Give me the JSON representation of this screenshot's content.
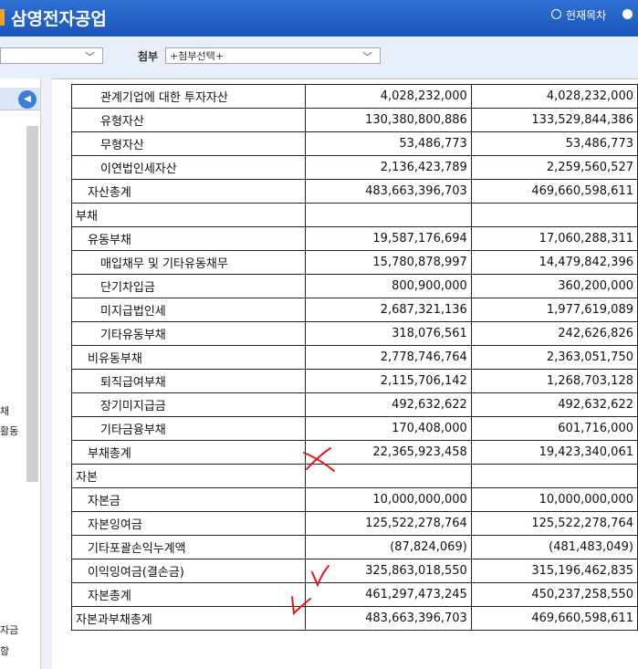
{
  "header": {
    "title": "삼영전자공업",
    "radio_label": "현재목차"
  },
  "filters": {
    "attach_label": "첨부",
    "attach_value": "+첨부선택+"
  },
  "left_panel": {
    "fragments": [
      "채",
      "활동",
      "자금",
      "항"
    ]
  },
  "table": {
    "rows": [
      {
        "label": "관계기업에 대한 투자자산",
        "level": 2,
        "v1": "4,028,232,000",
        "v2": "4,028,232,000"
      },
      {
        "label": "유형자산",
        "level": 2,
        "v1": "130,380,800,886",
        "v2": "133,529,844,386"
      },
      {
        "label": "무형자산",
        "level": 2,
        "v1": "53,486,773",
        "v2": "53,486,773"
      },
      {
        "label": "이연법인세자산",
        "level": 2,
        "v1": "2,136,423,789",
        "v2": "2,259,560,527"
      },
      {
        "label": "자산총계",
        "level": 1,
        "v1": "483,663,396,703",
        "v2": "469,660,598,611"
      },
      {
        "label": "부채",
        "level": 0,
        "v1": "",
        "v2": ""
      },
      {
        "label": "유동부채",
        "level": 1,
        "v1": "19,587,176,694",
        "v2": "17,060,288,311"
      },
      {
        "label": "매입채무 및 기타유동채무",
        "level": 2,
        "v1": "15,780,878,997",
        "v2": "14,479,842,396"
      },
      {
        "label": "단기차입금",
        "level": 2,
        "v1": "800,900,000",
        "v2": "360,200,000"
      },
      {
        "label": "미지급법인세",
        "level": 2,
        "v1": "2,687,321,136",
        "v2": "1,977,619,089"
      },
      {
        "label": "기타유동부채",
        "level": 2,
        "v1": "318,076,561",
        "v2": "242,626,826"
      },
      {
        "label": "비유동부채",
        "level": 1,
        "v1": "2,778,746,764",
        "v2": "2,363,051,750"
      },
      {
        "label": "퇴직급여부채",
        "level": 2,
        "v1": "2,115,706,142",
        "v2": "1,268,703,128"
      },
      {
        "label": "장기미지급금",
        "level": 2,
        "v1": "492,632,622",
        "v2": "492,632,622"
      },
      {
        "label": "기타금융부채",
        "level": 2,
        "v1": "170,408,000",
        "v2": "601,716,000"
      },
      {
        "label": "부채총계",
        "level": 1,
        "v1": "22,365,923,458",
        "v2": "19,423,340,061"
      },
      {
        "label": "자본",
        "level": 0,
        "v1": "",
        "v2": ""
      },
      {
        "label": "자본금",
        "level": 1,
        "v1": "10,000,000,000",
        "v2": "10,000,000,000"
      },
      {
        "label": "자본잉여금",
        "level": 1,
        "v1": "125,522,278,764",
        "v2": "125,522,278,764"
      },
      {
        "label": "기타포괄손익누계액",
        "level": 1,
        "v1": "(87,824,069)",
        "v2": "(481,483,049)"
      },
      {
        "label": "이익잉여금(결손금)",
        "level": 1,
        "v1": "325,863,018,550",
        "v2": "315,196,462,835"
      },
      {
        "label": "자본총계",
        "level": 1,
        "v1": "461,297,473,245",
        "v2": "450,237,258,550"
      },
      {
        "label": "자본과부채총계",
        "level": 0,
        "v1": "483,663,396,703",
        "v2": "469,660,598,611"
      }
    ]
  },
  "annotations": {
    "color": "#e8141c",
    "marks": [
      {
        "kind": "x-mark",
        "row": "부채총계"
      },
      {
        "kind": "check-mark",
        "row": "이익잉여금(결손금)"
      },
      {
        "kind": "check-mark",
        "row": "자본총계"
      }
    ]
  }
}
